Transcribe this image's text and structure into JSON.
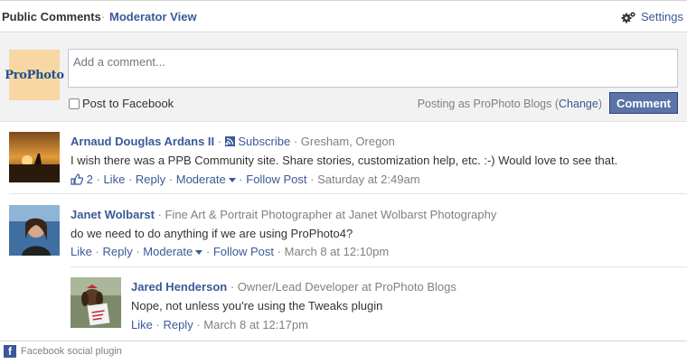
{
  "header": {
    "tab_public": "Public Comments",
    "separator": "·",
    "tab_moderator": "Moderator View",
    "settings_label": "Settings"
  },
  "composer": {
    "avatar_text": "ProPhoto",
    "placeholder": "Add a comment...",
    "post_to_facebook": "Post to Facebook",
    "posting_as": "Posting as ProPhoto Blogs (",
    "change_link": "Change",
    "posting_as_close": ")",
    "comment_button": "Comment"
  },
  "comments": [
    {
      "author": "Arnaud Douglas Ardans II",
      "subscribe": "Subscribe",
      "meta": "· Gresham, Oregon",
      "text": "I wish there was a PPB Community site. Share stories, customization help, etc. :-) Would love to see that.",
      "like_count": "2",
      "like": "Like",
      "reply": "Reply",
      "moderate": "Moderate",
      "follow": "Follow Post",
      "time": "Saturday at 2:49am"
    },
    {
      "author": "Janet Wolbarst",
      "meta": "· Fine Art & Portrait Photographer at Janet Wolbarst Photography",
      "text": "do we need to do anything if we are using ProPhoto4?",
      "like": "Like",
      "reply": "Reply",
      "moderate": "Moderate",
      "follow": "Follow Post",
      "time": "March 8 at 12:10pm"
    }
  ],
  "reply": {
    "author": "Jared Henderson",
    "meta": "· Owner/Lead Developer at ProPhoto Blogs",
    "text": "Nope, not unless you're using the Tweaks plugin",
    "like": "Like",
    "reply": "Reply",
    "time": "March 8 at 12:17pm"
  },
  "footer": {
    "badge": "f",
    "text": "Facebook social plugin"
  }
}
